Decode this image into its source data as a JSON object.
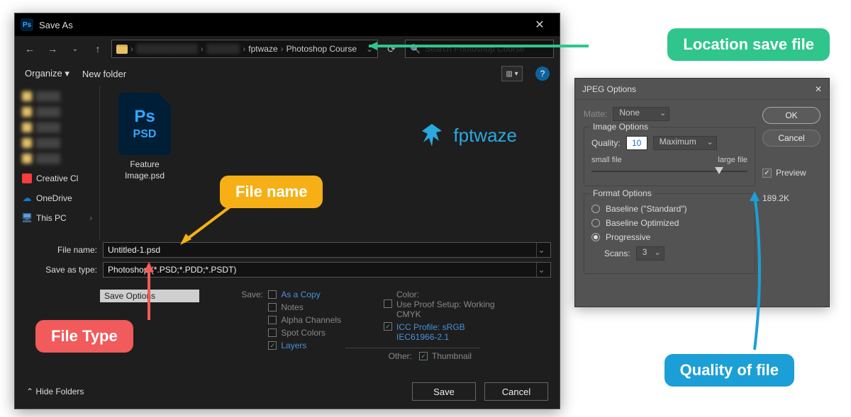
{
  "saveas": {
    "title": "Save As",
    "nav": {
      "path_blur1": "New Voxans (D)",
      "path_blur2": "Trang de",
      "crumb1": "fptwaze",
      "crumb2": "Photoshop Course",
      "search_placeholder": "Search Photoshop Course"
    },
    "toolbar": {
      "organize": "Organize ▾",
      "newfolder": "New folder"
    },
    "sidebar": {
      "creative": "Creative Cl",
      "onedrive": "OneDrive",
      "thispc": "This PC"
    },
    "file_thumb": {
      "ps": "Ps",
      "ext": "PSD",
      "label": "Feature Image.psd"
    },
    "brand": "fptwaze",
    "form": {
      "filename_label": "File name:",
      "filename_value": "Untitled-1.psd",
      "saveastype_label": "Save as type:",
      "saveastype_value": "Photoshop (*.PSD;*.PDD;*.PSDT)"
    },
    "options": {
      "save_options_header": "Save Options",
      "save_label": "Save:",
      "as_copy": "As a Copy",
      "notes": "Notes",
      "alpha": "Alpha Channels",
      "spot": "Spot Colors",
      "layers": "Layers",
      "color_label": "Color:",
      "use_proof": "Use Proof Setup: Working CMYK",
      "icc": "ICC Profile:  sRGB IEC61966-2.1",
      "other_label": "Other:",
      "thumbnail": "Thumbnail"
    },
    "footer": {
      "hide": "Hide Folders",
      "save": "Save",
      "cancel": "Cancel"
    }
  },
  "jpeg": {
    "title": "JPEG Options",
    "matte_label": "Matte:",
    "matte_value": "None",
    "image_options": "Image Options",
    "quality_label": "Quality:",
    "quality_value": "10",
    "quality_preset": "Maximum",
    "slider_small": "small file",
    "slider_large": "large file",
    "slider_pos_pct": 82,
    "format_options": "Format Options",
    "baseline_std": "Baseline (\"Standard\")",
    "baseline_opt": "Baseline Optimized",
    "progressive": "Progressive",
    "scans_label": "Scans:",
    "scans_value": "3",
    "ok": "OK",
    "cancel": "Cancel",
    "preview": "Preview",
    "filesize": "189.2K"
  },
  "callouts": {
    "location": "Location save file",
    "filename": "File name",
    "filetype": "File Type",
    "quality": "Quality of file"
  }
}
